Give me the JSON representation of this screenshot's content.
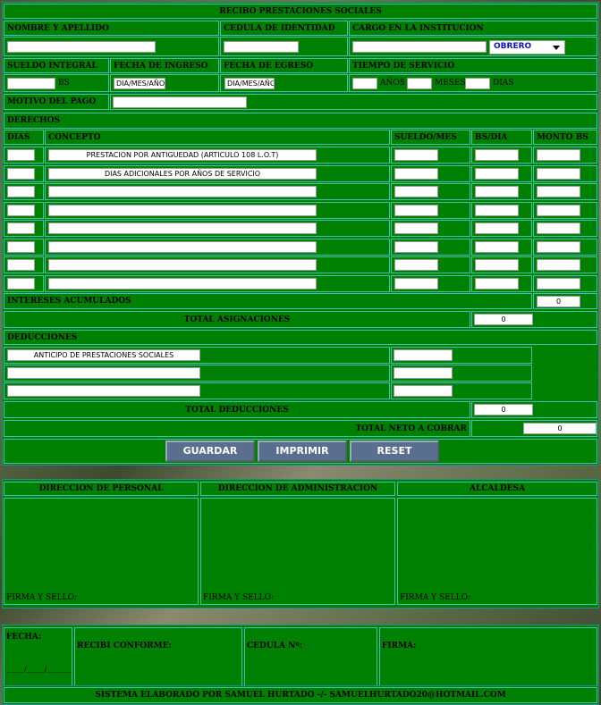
{
  "form": {
    "title": "RECIBO PRESTACIONES SOCIALES",
    "labels": {
      "nombre": "NOMBRE Y APELLIDO",
      "cedula": "CEDULA DE IDENTIDAD",
      "cargo": "CARGO EN LA INSTITUCION",
      "sueldo": "SUELDO INTEGRAL",
      "ingreso": "FECHA DE INGRESO",
      "egreso": "FECHA DE EGRESO",
      "tiempo": "TIEMPO DE SERVICIO",
      "bs": "BS",
      "anos": "AÑOS",
      "meses": "MESES",
      "dias": "DIAS",
      "motivo": "MOTIVO DEL PAGO"
    },
    "cargo_selected": "OBRERO",
    "fecha_ingreso_value": "DIA/MES/AÑO",
    "fecha_egreso_value": "DIA/MES/AÑO"
  },
  "derechos": {
    "title": "DERECHOS",
    "headers": {
      "dias": "DIAS",
      "concepto": "CONCEPTO",
      "sueldo_mes": "SUELDO/MES",
      "bs_dia": "BS/DIA",
      "monto": "MONTO BS"
    },
    "concepts": [
      "PRESTACION POR ANTIGUEDAD (ARTICULO 108 L.O.T)",
      "DIAS ADICIONALES POR AÑOS DE SERVICIO",
      "",
      "",
      "",
      "",
      "",
      ""
    ],
    "intereses_label": "INTERESES ACUMULADOS",
    "intereses_value": "0",
    "total_label": "TOTAL ASIGNACIONES",
    "total_value": "0"
  },
  "deducciones": {
    "title": "DEDUCCIONES",
    "concepts": [
      "ANTICIPO DE PRESTACIONES SOCIALES",
      "",
      ""
    ],
    "total_label": "TOTAL DEDUCCIONES",
    "total_value": "0",
    "neto_label": "TOTAL NETO A COBRAR",
    "neto_value": "0"
  },
  "buttons": {
    "guardar": "GUARDAR",
    "imprimir": "IMPRIMIR",
    "reset": "RESET"
  },
  "firmas": {
    "personal": "DIRECCION DE PERSONAL",
    "administracion": "DIRECCION DE ADMINISTRACION",
    "alcaldesa": "ALCALDESA",
    "firma_sello": "FIRMA Y SELLO:"
  },
  "recibo": {
    "fecha": "FECHA:",
    "fecha_blank": "_____/_____/_______",
    "conforme": "RECIBI CONFORME:",
    "cedula": "CEDULA Nº:",
    "firma": "FIRMA:"
  },
  "footer": "SISTEMA ELABORADO POR SAMUEL HURTADO -/- SAMUELHURTADO20@HOTMAIL.COM",
  "colors": {
    "panel": "#008000",
    "border": "#40c0b0",
    "button": "#5a6e90"
  }
}
